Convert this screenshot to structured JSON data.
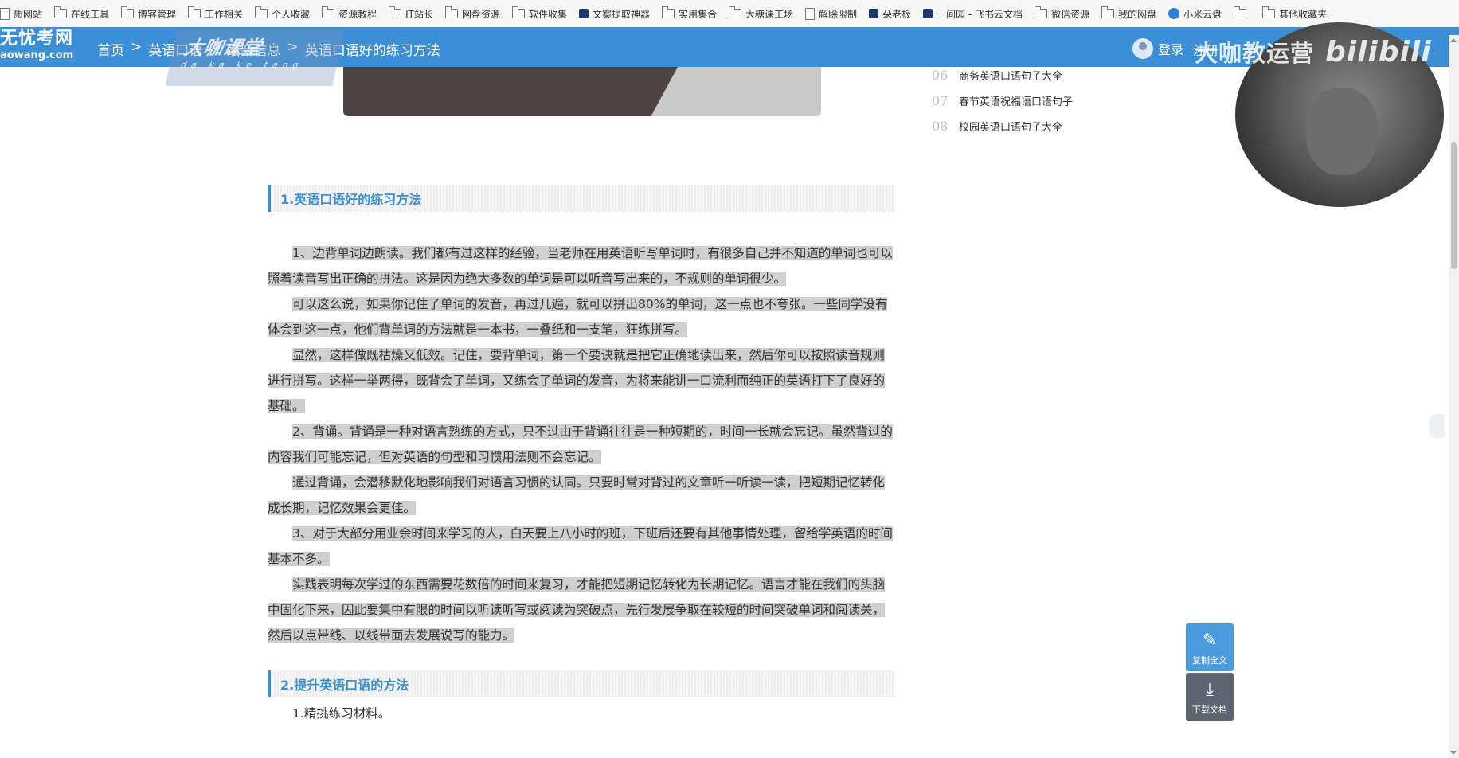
{
  "bookmarks": [
    {
      "label": "质网站",
      "icon": "page"
    },
    {
      "label": "在线工具",
      "icon": "folder"
    },
    {
      "label": "博客管理",
      "icon": "folder"
    },
    {
      "label": "工作相关",
      "icon": "folder"
    },
    {
      "label": "个人收藏",
      "icon": "folder"
    },
    {
      "label": "资源教程",
      "icon": "folder"
    },
    {
      "label": "IT站长",
      "icon": "folder"
    },
    {
      "label": "网盘资源",
      "icon": "folder"
    },
    {
      "label": "软件收集",
      "icon": "folder"
    },
    {
      "label": "文案提取神器",
      "icon": "square"
    },
    {
      "label": "实用集合",
      "icon": "folder"
    },
    {
      "label": "大糖课工场",
      "icon": "folder"
    },
    {
      "label": "解除限制",
      "icon": "page"
    },
    {
      "label": "朵老板",
      "icon": "square"
    },
    {
      "label": "一间园 - 飞书云文档",
      "icon": "square"
    },
    {
      "label": "微信资源",
      "icon": "folder"
    },
    {
      "label": "我的网盘",
      "icon": "folder"
    },
    {
      "label": "小米云盘",
      "icon": "cloud"
    },
    {
      "label": "",
      "icon": "folder"
    },
    {
      "label": "其他收藏夹",
      "icon": "folder"
    }
  ],
  "header": {
    "logo_line1": "无忧考网",
    "logo_line2": "aowang.com",
    "breadcrumb": [
      "首页",
      "英语口语",
      "最新信息",
      "英语口语好的练习方法"
    ],
    "breadcrumb_sep": ">",
    "login": "登录",
    "register": "注册"
  },
  "watermarks": {
    "left_main": "大咖课堂",
    "left_sub": "da ka ke tang",
    "right_main": "大咖教运营",
    "right_bili": "bilibili"
  },
  "side_list": [
    {
      "num": "06",
      "title": "商务英语口语句子大全"
    },
    {
      "num": "07",
      "title": "春节英语祝福语口语句子"
    },
    {
      "num": "08",
      "title": "校园英语口语句子大全"
    }
  ],
  "article": {
    "section1_title": "1.英语口语好的练习方法",
    "paragraphs": [
      "1、边背单词边朗读。我们都有过这样的经验，当老师在用英语听写单词时，有很多自己并不知道的单词也可以照着读音写出正确的拼法。这是因为绝大多数的单词是可以听音写出来的，不规则的单词很少。",
      "可以这么说，如果你记住了单词的发音，再过几遍，就可以拼出80%的单词，这一点也不夸张。一些同学没有体会到这一点，他们背单词的方法就是一本书，一叠纸和一支笔，狂练拼写。",
      "显然，这样做既枯燥又低效。记住，要背单词，第一个要诀就是把它正确地读出来，然后你可以按照读音规则进行拼写。这样一举两得，既背会了单词，又练会了单词的发音，为将来能讲一口流利而纯正的英语打下了良好的基础。",
      "2、背诵。背诵是一种对语言熟练的方式，只不过由于背诵往往是一种短期的，时间一长就会忘记。虽然背过的内容我们可能忘记，但对英语的句型和习惯用法则不会忘记。",
      "通过背诵，会潜移默化地影响我们对语言习惯的认同。只要时常对背过的文章听一听读一读，把短期记忆转化成长期，记忆效果会更佳。",
      "3、对于大部分用业余时间来学习的人，白天要上八小时的班，下班后还要有其他事情处理，留给学英语的时间基本不多。",
      "实践表明每次学过的东西需要花数倍的时间来复习，才能把短期记忆转化为长期记忆。语言才能在我们的头脑中固化下来，因此要集中有限的时间以听读听写或阅读为突破点，先行发展争取在较短的时间突破单词和阅读关，然后以点带线、以线带面去发展说写的能力。"
    ],
    "section2_title": "2.提升英语口语的方法",
    "section2_first_item": "1.精挑练习材料。"
  },
  "float_buttons": {
    "copy_label": "复制全文",
    "download_label": "下载文档"
  }
}
